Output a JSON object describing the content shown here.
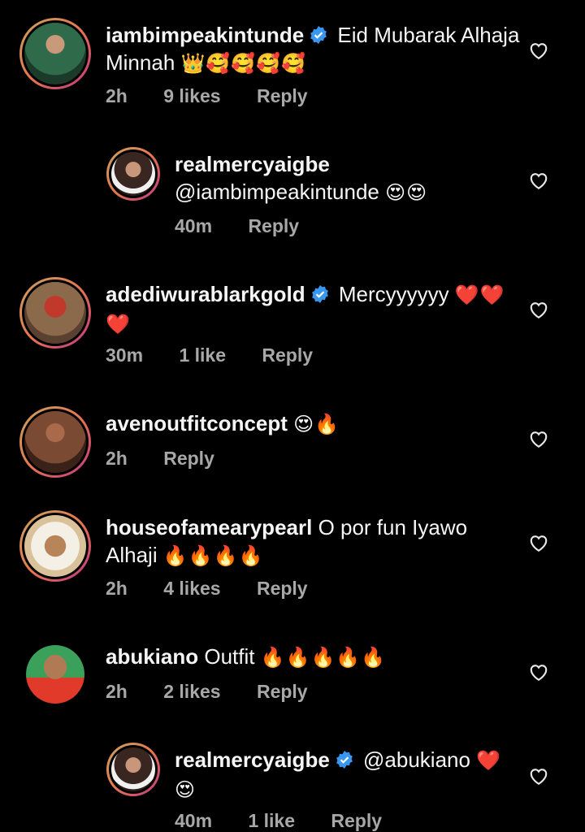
{
  "comments": [
    {
      "username": "iambimpeakintunde",
      "verified": true,
      "text": "Eid Mubarak Alhaja Minnah",
      "emojis": "👑🥰🥰🥰🥰",
      "time": "2h",
      "likes": "9 likes",
      "reply": "Reply",
      "avatar_colors": [
        "#2f6b4a",
        "#1b3a2a"
      ]
    },
    {
      "username": "realmercyaigbe",
      "verified": false,
      "text": "@iambimpeakintunde",
      "emojis": "😍😍",
      "time": "40m",
      "likes": "",
      "reply": "Reply",
      "avatar_colors": [
        "#5a3c2e",
        "#2b1c17"
      ]
    },
    {
      "username": "adediwurablarkgold",
      "verified": true,
      "text": "Mercyyyyyy",
      "emojis": "❤️❤️❤️",
      "time": "30m",
      "likes": "1 like",
      "reply": "Reply",
      "avatar_colors": [
        "#b85a3a",
        "#6b4a33"
      ]
    },
    {
      "username": "avenoutfitconcept",
      "verified": false,
      "text": "",
      "emojis": "😍🔥",
      "time": "2h",
      "likes": "",
      "reply": "Reply",
      "avatar_colors": [
        "#8a5a3c",
        "#4a2e22"
      ]
    },
    {
      "username": "houseofamearypearl",
      "verified": false,
      "text": "O por fun Iyawo Alhaji",
      "emojis": "🔥🔥🔥🔥",
      "time": "2h",
      "likes": "4 likes",
      "reply": "Reply",
      "avatar_colors": [
        "#d9c29a",
        "#7a5a3a"
      ]
    },
    {
      "username": "abukiano",
      "verified": false,
      "text": "Outfit",
      "emojis": "🔥🔥🔥🔥🔥",
      "time": "2h",
      "likes": "2 likes",
      "reply": "Reply",
      "avatar_colors": [
        "#e23a2a",
        "#3aa05a"
      ]
    },
    {
      "username": "realmercyaigbe",
      "verified": true,
      "text": "@abukiano",
      "emojis": "❤️😍",
      "time": "40m",
      "likes": "1 like",
      "reply": "Reply",
      "avatar_colors": [
        "#5a3c2e",
        "#2b1c17"
      ]
    }
  ]
}
